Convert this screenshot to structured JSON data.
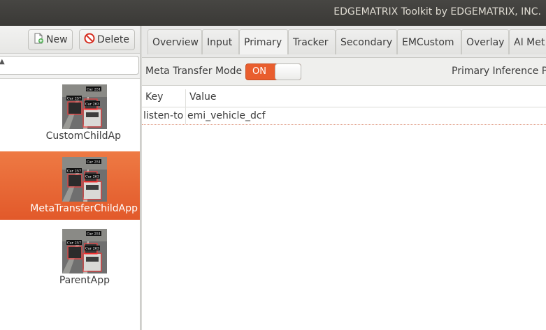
{
  "window": {
    "title": "EDGEMATRIX Toolkit by EDGEMATRIX, INC."
  },
  "toolbar": {
    "new_label": "New",
    "delete_label": "Delete"
  },
  "apps": [
    {
      "name": "CustomChildAp",
      "selected": false
    },
    {
      "name": "MetaTransferChildApp",
      "selected": true
    },
    {
      "name": "ParentApp",
      "selected": false
    }
  ],
  "thumbnail_labels": {
    "car_a": "Car 251",
    "car_b": "Car 257",
    "car_c": "Car 263"
  },
  "tabs": [
    "Overview",
    "Input",
    "Primary",
    "Tracker",
    "Secondary",
    "EMCustom",
    "Overlay",
    "AI Met"
  ],
  "active_tab": "Primary",
  "mode": {
    "label": "Meta Transfer Mode",
    "switch_state": "ON",
    "primary_inference_text": "Primary Inference Pr"
  },
  "table": {
    "columns": {
      "key": "Key",
      "value": "Value"
    },
    "rows": [
      {
        "key": "listen-to",
        "value": "emi_vehicle_dcf"
      }
    ]
  },
  "colors": {
    "accent": "#e95e2e",
    "titlebar": "#3d3c39"
  }
}
